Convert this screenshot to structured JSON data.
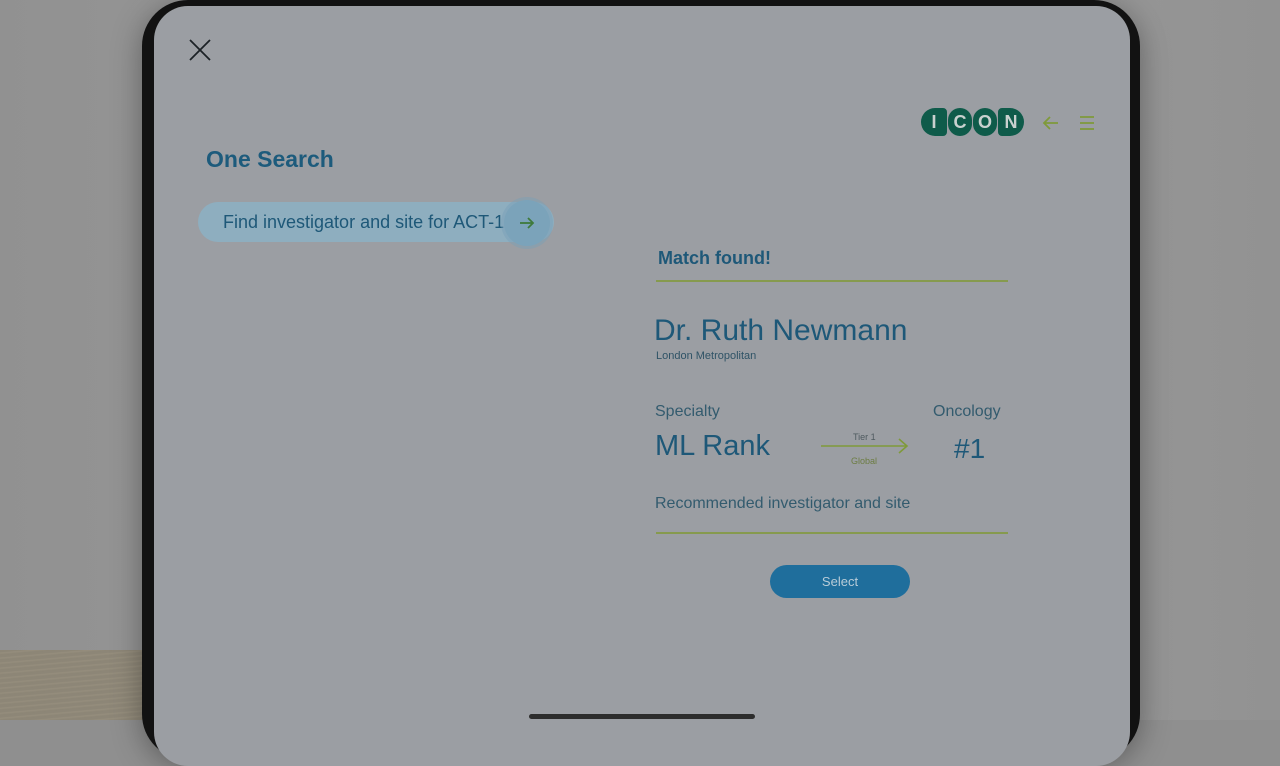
{
  "app": {
    "logo_letters": [
      "I",
      "C",
      "O",
      "N"
    ],
    "title": "One Search"
  },
  "icons": {
    "close": "close-icon",
    "back": "arrow-left-icon",
    "menu": "hamburger-menu-icon",
    "search_go": "arrow-right-icon"
  },
  "search": {
    "query": "Find investigator and site for ACT-1"
  },
  "result": {
    "heading": "Match found!",
    "doctor_name": "Dr. Ruth Newmann",
    "doctor_site": "London Metropolitan",
    "specialty_label": "Specialty",
    "specialty_value": "Oncology",
    "rank_label": "ML Rank",
    "tier_label": "Tier 1",
    "scope_label": "Global",
    "rank_value": "#1",
    "recommendation": "Recommended investigator and site",
    "select_label": "Select"
  },
  "colors": {
    "brand_green": "#0f5b4a",
    "accent_lime": "#869a4e",
    "primary_blue": "#1f6e9c",
    "text_blue": "#1e5878"
  }
}
